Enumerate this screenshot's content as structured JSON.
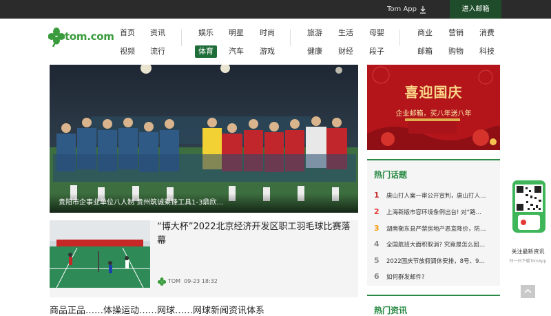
{
  "topbar": {
    "app_label": "Tom App",
    "mail_label": "进入邮箱"
  },
  "logo": {
    "text": "tom.com"
  },
  "nav": {
    "group1": [
      "首页",
      "资讯",
      "视频",
      "流行"
    ],
    "group2": [
      "娱乐",
      "明星",
      "时尚",
      "体育",
      "汽车",
      "游戏"
    ],
    "group3": [
      "旅游",
      "生活",
      "母婴",
      "健康",
      "财经",
      "段子"
    ],
    "group4": [
      "商业",
      "营销",
      "消费",
      "邮箱",
      "购物",
      "科技"
    ],
    "active": "体育"
  },
  "hero": {
    "caption": "贵阳市企事业单位八人制 贵州筑诚乘锋工具1-3鼎欣..."
  },
  "card": {
    "title": "“博大杯”2022北京经济开发区职工羽毛球比赛落幕",
    "source": "TOM",
    "time": "09-23 18:32"
  },
  "bottom_text": "商品正品……体操运动……网球……网球新闻资讯体系",
  "banner": {
    "title": "喜迎国庆",
    "subtitle": "企业邮箱，买八年送八年"
  },
  "hot_topics": {
    "title": "热门话题",
    "items": [
      {
        "rank": "1",
        "text": "唐山打人案一审公开宣判，唐山打人…"
      },
      {
        "rank": "2",
        "text": "上海新版市容环境条例出台! 对“路…"
      },
      {
        "rank": "3",
        "text": "湖南衡东县严禁房地产恶意降价，防…"
      },
      {
        "rank": "4",
        "text": "全国航班大面积取消? 究竟是怎么回…"
      },
      {
        "rank": "5",
        "text": "2022国庆节放假调休安排，8号、9…"
      },
      {
        "rank": "6",
        "text": "如何群发邮件?"
      }
    ]
  },
  "hot_news": {
    "title": "热门资讯"
  },
  "qr": {
    "label": "关注最新资讯",
    "sub": "扫一扫下载TomApp"
  },
  "colors": {
    "brand_green": "#2a8a45",
    "nav_active": "#1f6e3a",
    "topbar": "#2b2b2b"
  }
}
